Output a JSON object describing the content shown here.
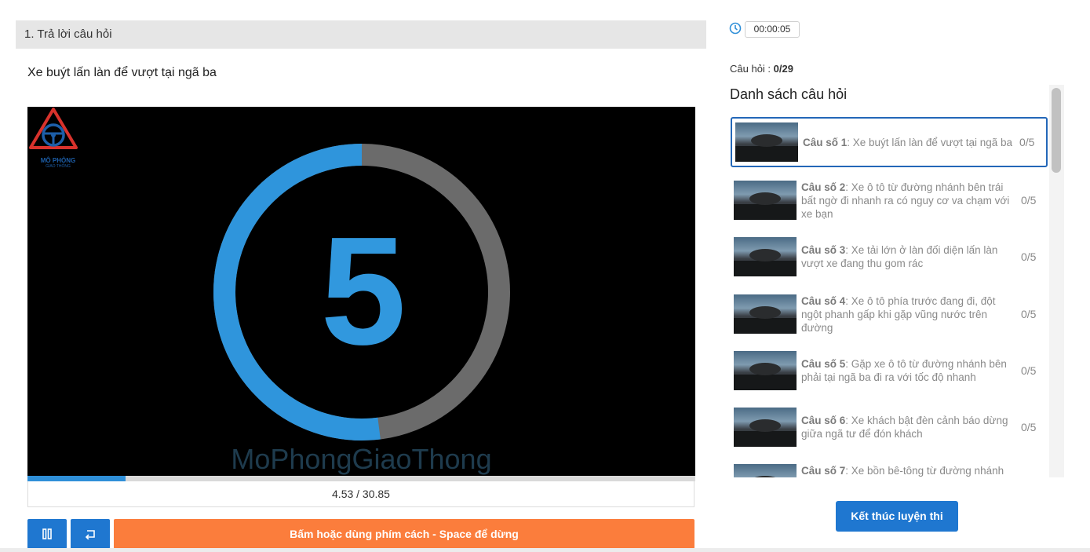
{
  "section": {
    "title": "1. Trả lời câu hỏi"
  },
  "question": {
    "text": "Xe buýt lấn làn để vượt tại ngã ba"
  },
  "video": {
    "countdown_number": "5",
    "watermark": "MoPhongGiaoThong",
    "logo_title": "MÔ PHỎNG",
    "logo_subtitle": "GIAO THÔNG",
    "countdown_fraction": 0.52,
    "progress_fraction": 0.147,
    "time_display": "4.53 / 30.85",
    "colors": {
      "ring_fill": "#2f95dc",
      "ring_track": "#6b6b6b",
      "number": "#3198de"
    }
  },
  "controls": {
    "pause_icon": "pause-icon",
    "replay_icon": "replay-icon",
    "stop_label": "Bấm hoặc dùng phím cách - Space để dừng"
  },
  "sidebar": {
    "timer": "00:00:05",
    "count_label": "Câu hỏi :",
    "count_value": "0/29",
    "list_title": "Danh sách câu hỏi",
    "items": [
      {
        "label": "Câu số 1",
        "text": ": Xe buýt lấn làn để vượt tại ngã ba",
        "score": "0/5"
      },
      {
        "label": "Câu số 2",
        "text": ": Xe ô tô từ đường nhánh bên trái bất ngờ đi nhanh ra có nguy cơ va chạm với xe bạn",
        "score": "0/5"
      },
      {
        "label": "Câu số 3",
        "text": ": Xe tải lớn ở làn đối diện lấn làn vượt xe đang thu gom rác",
        "score": "0/5"
      },
      {
        "label": "Câu số 4",
        "text": ": Xe ô tô phía trước đang đi, đột ngột phanh gấp khi gặp vũng nước trên đường",
        "score": "0/5"
      },
      {
        "label": "Câu số 5",
        "text": ": Gặp xe ô tô từ đường nhánh bên phải tại ngã ba đi ra với tốc độ nhanh",
        "score": "0/5"
      },
      {
        "label": "Câu số 6",
        "text": ": Xe khách bật đèn cảnh báo dừng giữa ngã tư để đón khách",
        "score": "0/5"
      },
      {
        "label": "Câu số 7",
        "text": ": Xe bồn bê-tông từ đường nhánh",
        "score": ""
      }
    ],
    "finish_label": "Kết thúc luyện thi"
  }
}
